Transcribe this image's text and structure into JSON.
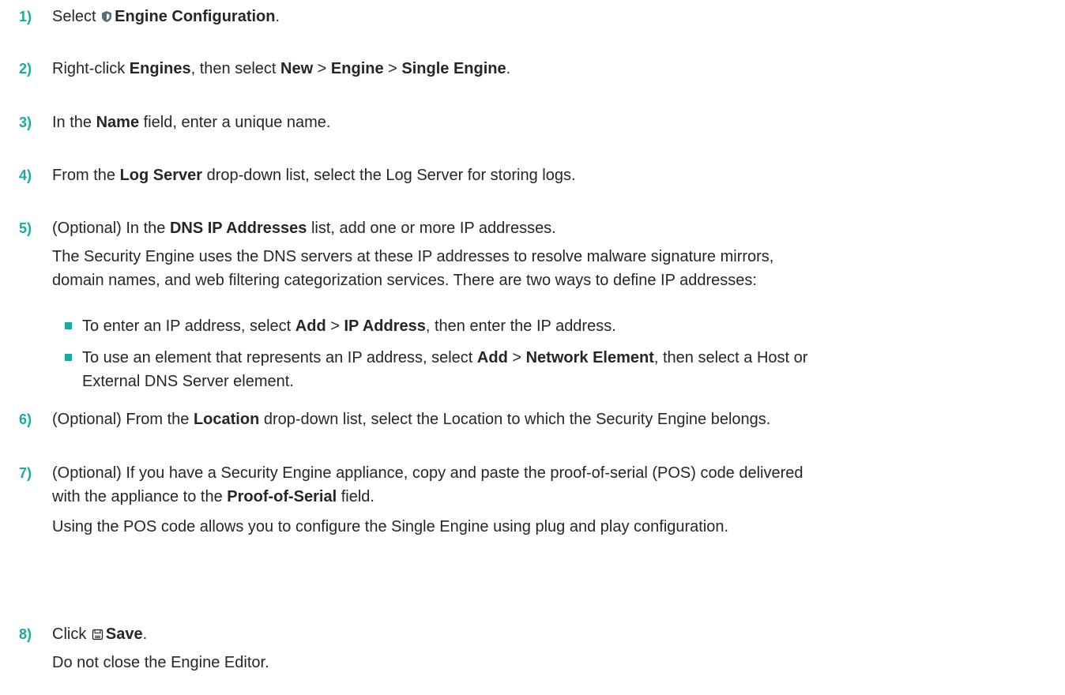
{
  "colors": {
    "accent": "#1aab9b",
    "text": "#262626"
  },
  "steps": [
    {
      "num": "1)",
      "t1": "Select ",
      "icon": "shield-icon",
      "b1": "Engine Configuration",
      "t2": "."
    },
    {
      "num": "2)",
      "t1": "Right-click ",
      "b1": "Engines",
      "t2": ", then select ",
      "b2": "New",
      "t3": " > ",
      "b3": "Engine",
      "t4": " > ",
      "b4": "Single Engine",
      "t5": "."
    },
    {
      "num": "3)",
      "t1": "In the ",
      "b1": "Name",
      "t2": " field, enter a unique name."
    },
    {
      "num": "4)",
      "t1": "From the ",
      "b1": "Log Server",
      "t2": " drop-down list, select the Log Server for storing logs."
    },
    {
      "num": "5)",
      "t1": "(Optional) In the ",
      "b1": "DNS IP Addresses",
      "t2": " list, add one or more IP addresses.",
      "para1": "The Security Engine uses the DNS servers at these IP addresses to resolve malware signature mirrors,",
      "para2": "domain names, and web filtering categorization services. There are two ways to define IP addresses:",
      "bullets": [
        {
          "t1": "To enter an IP address, select ",
          "b1": "Add",
          "t2": " > ",
          "b2": "IP Address",
          "t3": ", then enter the IP address."
        },
        {
          "t1": "To use an element that represents an IP address, select ",
          "b1": "Add",
          "t2": " > ",
          "b2": "Network Element",
          "t3": ", then select a Host or",
          "l2": "External DNS Server element."
        }
      ]
    },
    {
      "num": "6)",
      "t1": "(Optional) From the ",
      "b1": "Location",
      "t2": " drop-down list, select the Location to which the Security Engine belongs."
    },
    {
      "num": "7)",
      "t1": "(Optional) If you have a Security Engine appliance, copy and paste the proof-of-serial (POS) code delivered",
      "l2a": "with the appliance to the ",
      "l2b": "Proof-of-Serial",
      "l2c": " field.",
      "para1": "Using the POS code allows you to configure the Single Engine using plug and play configuration."
    },
    {
      "num": "8)",
      "t1": "Click ",
      "icon": "save-icon",
      "b1": "Save",
      "t2": ".",
      "para1": "Do not close the Engine Editor."
    }
  ]
}
